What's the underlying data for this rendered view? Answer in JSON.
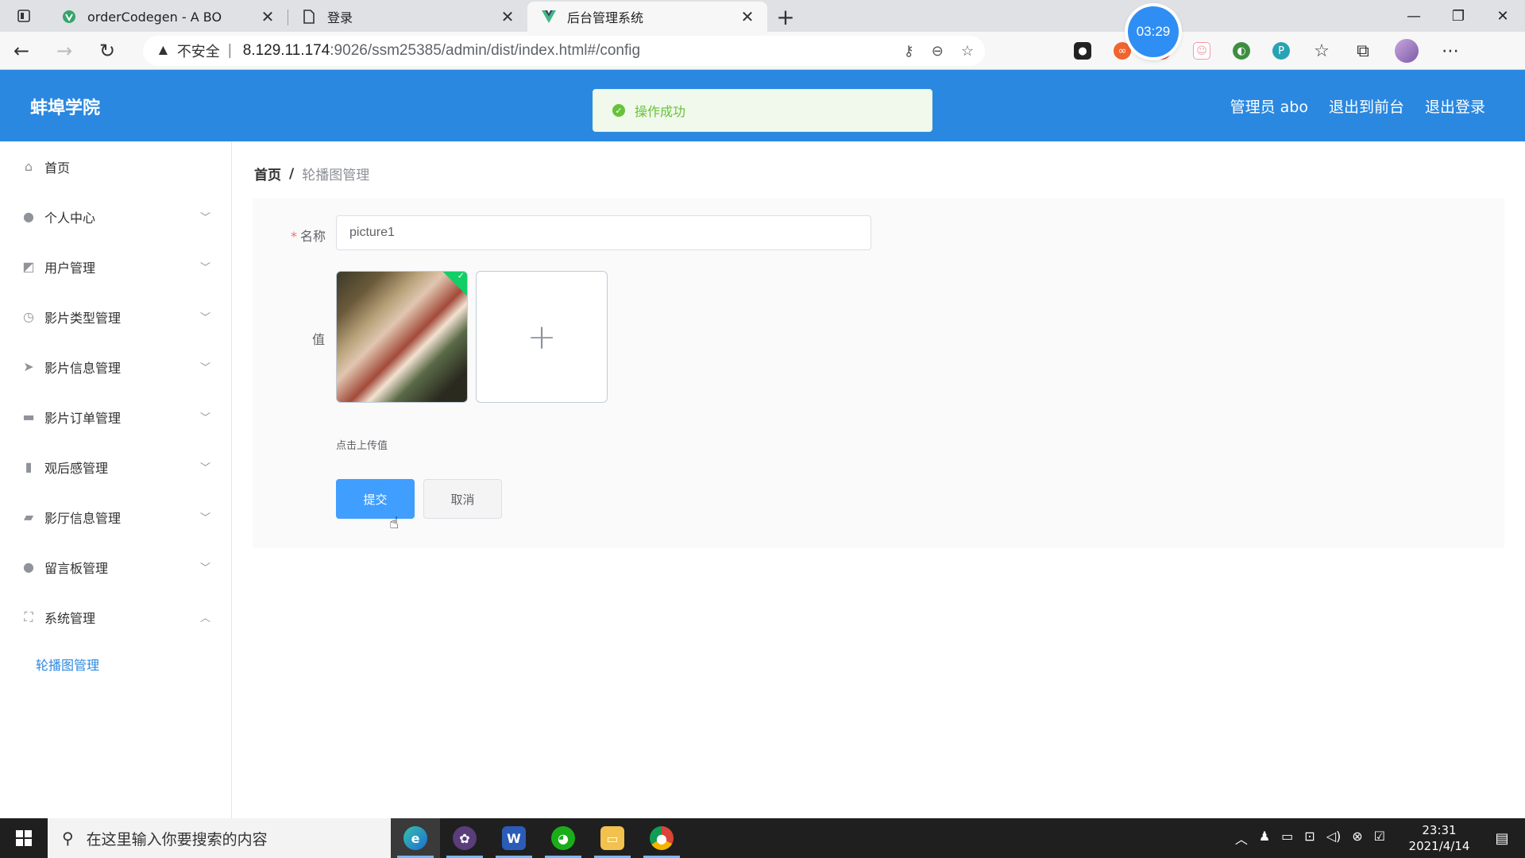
{
  "browser": {
    "tabs": [
      {
        "title": "orderCodegen - A BO",
        "icon": "vue-icon"
      },
      {
        "title": "登录",
        "icon": "page-icon"
      },
      {
        "title": "后台管理系统",
        "icon": "vue-icon"
      }
    ],
    "url_warning": "不安全",
    "url_host": "8.129.11.174",
    "url_path": ":9026/ssm25385/admin/dist/index.html#/config",
    "timer": "03:29"
  },
  "header": {
    "brand": "蚌埠学院",
    "admin": "管理员 abo",
    "to_front": "退出到前台",
    "logout": "退出登录"
  },
  "toast": {
    "message": "操作成功"
  },
  "sidebar": {
    "items": [
      {
        "label": "首页",
        "icon": "home-icon",
        "has_arrow": false
      },
      {
        "label": "个人中心",
        "icon": "user-icon",
        "has_arrow": true
      },
      {
        "label": "用户管理",
        "icon": "chart-icon",
        "has_arrow": true
      },
      {
        "label": "影片类型管理",
        "icon": "clock-icon",
        "has_arrow": true
      },
      {
        "label": "影片信息管理",
        "icon": "send-icon",
        "has_arrow": true
      },
      {
        "label": "影片订单管理",
        "icon": "briefcase-icon",
        "has_arrow": true
      },
      {
        "label": "观后感管理",
        "icon": "bar-chart-icon",
        "has_arrow": true
      },
      {
        "label": "影厅信息管理",
        "icon": "message-icon",
        "has_arrow": true
      },
      {
        "label": "留言板管理",
        "icon": "location-icon",
        "has_arrow": true
      },
      {
        "label": "系统管理",
        "icon": "fullscreen-icon",
        "has_arrow": true,
        "expanded": true
      }
    ],
    "sub_items": [
      {
        "label": "轮播图管理"
      }
    ]
  },
  "breadcrumb": {
    "home": "首页",
    "separator": "/",
    "current": "轮播图管理"
  },
  "form": {
    "name_label": "名称",
    "name_value": "picture1",
    "value_label": "值",
    "upload_tip": "点击上传值",
    "submit": "提交",
    "cancel": "取消"
  },
  "taskbar": {
    "search_placeholder": "在这里输入你要搜索的内容",
    "time": "23:31",
    "date": "2021/4/14"
  },
  "colors": {
    "primary": "#2b88e0",
    "success": "#67c23a",
    "button": "#409eff"
  }
}
